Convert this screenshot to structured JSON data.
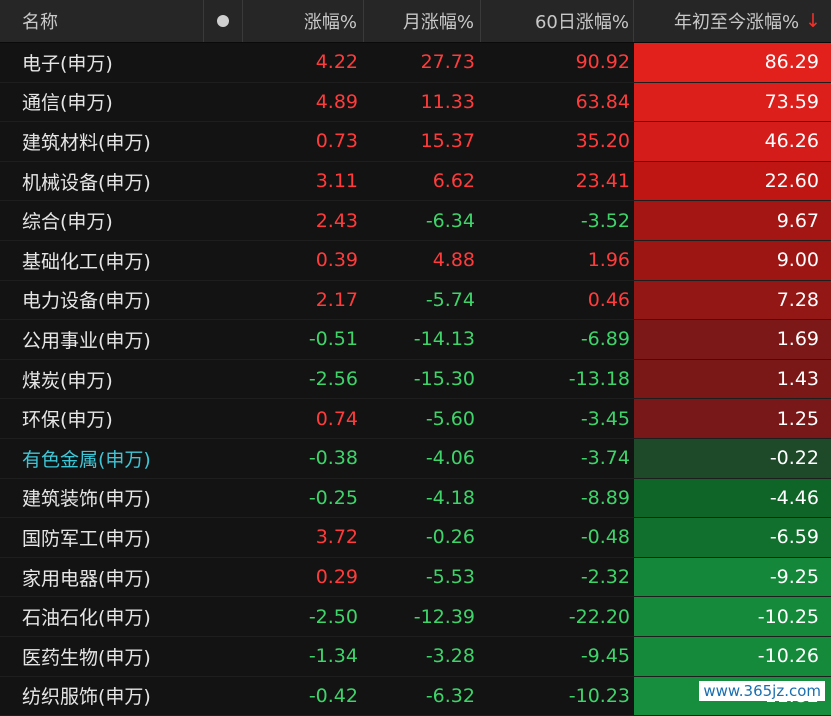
{
  "header": {
    "name": "名称",
    "change": "涨幅%",
    "month_change": "月涨幅%",
    "day60_change": "60日涨幅%",
    "ytd_change": "年初至今涨幅%",
    "sort_arrow": "↓"
  },
  "rows": [
    {
      "name": "电子(申万)",
      "change": "4.22",
      "month": "27.73",
      "d60": "90.92",
      "ytd": "86.29",
      "bg": "#e2201c"
    },
    {
      "name": "通信(申万)",
      "change": "4.89",
      "month": "11.33",
      "d60": "63.84",
      "ytd": "73.59",
      "bg": "#dc1f1b"
    },
    {
      "name": "建筑材料(申万)",
      "change": "0.73",
      "month": "15.37",
      "d60": "35.20",
      "ytd": "46.26",
      "bg": "#d41d1a"
    },
    {
      "name": "机械设备(申万)",
      "change": "3.11",
      "month": "6.62",
      "d60": "23.41",
      "ytd": "22.60",
      "bg": "#bf1613"
    },
    {
      "name": "综合(申万)",
      "change": "2.43",
      "month": "-6.34",
      "d60": "-3.52",
      "ytd": "9.67",
      "bg": "#a31614"
    },
    {
      "name": "基础化工(申万)",
      "change": "0.39",
      "month": "4.88",
      "d60": "1.96",
      "ytd": "9.00",
      "bg": "#9e1614"
    },
    {
      "name": "电力设备(申万)",
      "change": "2.17",
      "month": "-5.74",
      "d60": "0.46",
      "ytd": "7.28",
      "bg": "#931715"
    },
    {
      "name": "公用事业(申万)",
      "change": "-0.51",
      "month": "-14.13",
      "d60": "-6.89",
      "ytd": "1.69",
      "bg": "#7c1818"
    },
    {
      "name": "煤炭(申万)",
      "change": "-2.56",
      "month": "-15.30",
      "d60": "-13.18",
      "ytd": "1.43",
      "bg": "#7a1818"
    },
    {
      "name": "环保(申万)",
      "change": "0.74",
      "month": "-5.60",
      "d60": "-3.45",
      "ytd": "1.25",
      "bg": "#781818"
    },
    {
      "name": "有色金属(申万)",
      "change": "-0.38",
      "month": "-4.06",
      "d60": "-3.74",
      "ytd": "-0.22",
      "bg": "#1e4a2a",
      "highlight": true
    },
    {
      "name": "建筑装饰(申万)",
      "change": "-0.25",
      "month": "-4.18",
      "d60": "-8.89",
      "ytd": "-4.46",
      "bg": "#0f6428"
    },
    {
      "name": "国防军工(申万)",
      "change": "3.72",
      "month": "-0.26",
      "d60": "-0.48",
      "ytd": "-6.59",
      "bg": "#11702d"
    },
    {
      "name": "家用电器(申万)",
      "change": "0.29",
      "month": "-5.53",
      "d60": "-2.32",
      "ytd": "-9.25",
      "bg": "#15873a"
    },
    {
      "name": "石油石化(申万)",
      "change": "-2.50",
      "month": "-12.39",
      "d60": "-22.20",
      "ytd": "-10.25",
      "bg": "#168a3b"
    },
    {
      "name": "医药生物(申万)",
      "change": "-1.34",
      "month": "-3.28",
      "d60": "-9.45",
      "ytd": "-10.26",
      "bg": "#168a3b"
    },
    {
      "name": "纺织服饰(申万)",
      "change": "-0.42",
      "month": "-6.32",
      "d60": "-10.23",
      "ytd": "-11.82",
      "bg": "#178e3d"
    }
  ],
  "watermark": "www.365jz.com"
}
